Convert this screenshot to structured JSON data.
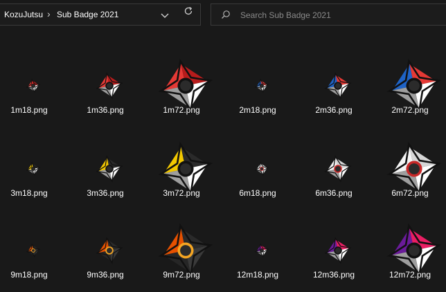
{
  "breadcrumb": {
    "folder_root": "KozuJutsu",
    "separator": "›",
    "folder_current": "Sub Badge 2021"
  },
  "search": {
    "placeholder": "Search Sub Badge 2021"
  },
  "icons": {
    "dropdown": "chevron-down-icon",
    "refresh": "refresh-icon",
    "search": "search-icon"
  },
  "files": [
    {
      "name": "1m18.png",
      "size": 18,
      "palette": {
        "a": "#e53935",
        "b": "#b71c1c",
        "c": "#ffffff",
        "d": "#9e9e9e",
        "ring": "#111111"
      }
    },
    {
      "name": "1m36.png",
      "size": 36,
      "palette": {
        "a": "#e53935",
        "b": "#b71c1c",
        "c": "#ffffff",
        "d": "#9e9e9e",
        "ring": "#111111"
      }
    },
    {
      "name": "1m72.png",
      "size": 72,
      "palette": {
        "a": "#e53935",
        "b": "#b71c1c",
        "c": "#ffffff",
        "d": "#9e9e9e",
        "ring": "#111111"
      }
    },
    {
      "name": "2m18.png",
      "size": 18,
      "palette": {
        "a": "#1e63c7",
        "b": "#e53935",
        "c": "#ffffff",
        "d": "#9e9e9e",
        "ring": "#111111"
      }
    },
    {
      "name": "2m36.png",
      "size": 36,
      "palette": {
        "a": "#1e63c7",
        "b": "#e53935",
        "c": "#ffffff",
        "d": "#9e9e9e",
        "ring": "#111111"
      }
    },
    {
      "name": "2m72.png",
      "size": 72,
      "palette": {
        "a": "#1e63c7",
        "b": "#e53935",
        "c": "#ffffff",
        "d": "#9e9e9e",
        "ring": "#111111"
      }
    },
    {
      "name": "3m18.png",
      "size": 18,
      "palette": {
        "a": "#f2c800",
        "b": "#2a2a2a",
        "c": "#ffffff",
        "d": "#9e9e9e",
        "ring": "#111111"
      }
    },
    {
      "name": "3m36.png",
      "size": 36,
      "palette": {
        "a": "#f2c800",
        "b": "#2a2a2a",
        "c": "#ffffff",
        "d": "#9e9e9e",
        "ring": "#111111"
      }
    },
    {
      "name": "3m72.png",
      "size": 72,
      "palette": {
        "a": "#f2c800",
        "b": "#2a2a2a",
        "c": "#ffffff",
        "d": "#9e9e9e",
        "ring": "#111111"
      }
    },
    {
      "name": "6m18.png",
      "size": 18,
      "palette": {
        "a": "#f5f5f5",
        "b": "#d6d6d6",
        "c": "#ffffff",
        "d": "#9e9e9e",
        "ring": "#c62828"
      }
    },
    {
      "name": "6m36.png",
      "size": 36,
      "palette": {
        "a": "#f5f5f5",
        "b": "#d6d6d6",
        "c": "#ffffff",
        "d": "#9e9e9e",
        "ring": "#c62828"
      }
    },
    {
      "name": "6m72.png",
      "size": 72,
      "palette": {
        "a": "#f5f5f5",
        "b": "#d6d6d6",
        "c": "#ffffff",
        "d": "#9e9e9e",
        "ring": "#c62828"
      }
    },
    {
      "name": "9m18.png",
      "size": 18,
      "palette": {
        "a": "#e65100",
        "b": "#2a2a2a",
        "c": "#3a3a3a",
        "d": "#262626",
        "ring": "#f5a623"
      }
    },
    {
      "name": "9m36.png",
      "size": 36,
      "palette": {
        "a": "#e65100",
        "b": "#2a2a2a",
        "c": "#3a3a3a",
        "d": "#262626",
        "ring": "#f5a623"
      }
    },
    {
      "name": "9m72.png",
      "size": 72,
      "palette": {
        "a": "#e65100",
        "b": "#2a2a2a",
        "c": "#3a3a3a",
        "d": "#262626",
        "ring": "#f5a623"
      }
    },
    {
      "name": "12m18.png",
      "size": 18,
      "palette": {
        "a": "#6a1b9a",
        "b": "#e91e63",
        "c": "#ffffff",
        "d": "#9e9e9e",
        "ring": "#111111"
      }
    },
    {
      "name": "12m36.png",
      "size": 36,
      "palette": {
        "a": "#6a1b9a",
        "b": "#e91e63",
        "c": "#ffffff",
        "d": "#9e9e9e",
        "ring": "#111111"
      }
    },
    {
      "name": "12m72.png",
      "size": 72,
      "palette": {
        "a": "#6a1b9a",
        "b": "#e91e63",
        "c": "#ffffff",
        "d": "#9e9e9e",
        "ring": "#111111"
      }
    }
  ]
}
